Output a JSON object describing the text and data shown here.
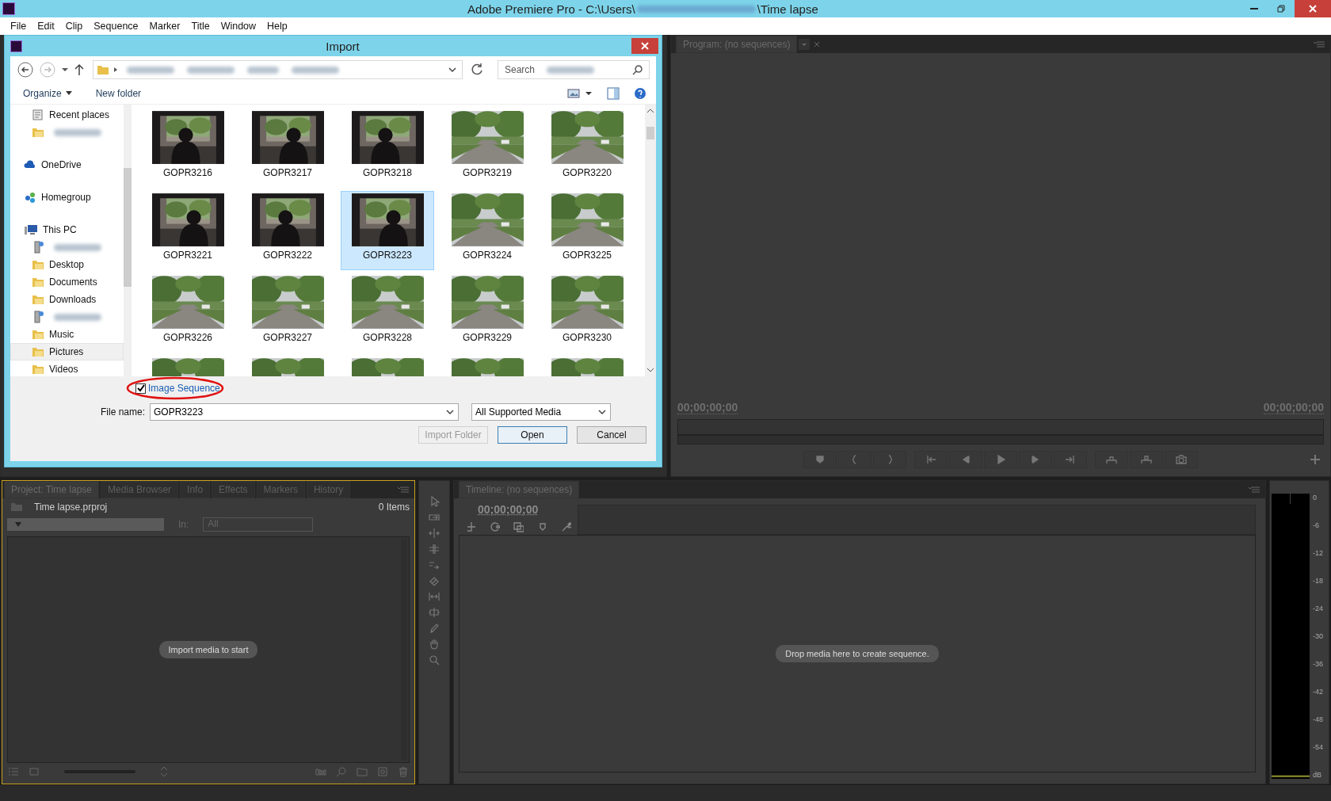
{
  "window": {
    "title_start": "Adobe Premiere Pro - C:\\Users\\",
    "title_end": "\\Time lapse"
  },
  "menu": [
    "File",
    "Edit",
    "Clip",
    "Sequence",
    "Marker",
    "Title",
    "Window",
    "Help"
  ],
  "import_dialog": {
    "title": "Import",
    "search": {
      "placeholder": "Search"
    },
    "organize": "Organize",
    "new_folder": "New folder",
    "sidebar": [
      {
        "kind": "item",
        "label": "Recent places",
        "selected": false
      },
      {
        "kind": "blurred",
        "selected": false
      },
      {
        "kind": "group",
        "label": "OneDrive",
        "selected": false
      },
      {
        "kind": "group",
        "label": "Homegroup",
        "selected": false
      },
      {
        "kind": "group",
        "label": "This PC",
        "selected": false
      },
      {
        "kind": "blurred",
        "selected": false
      },
      {
        "kind": "item",
        "label": "Desktop",
        "selected": false
      },
      {
        "kind": "item",
        "label": "Documents",
        "selected": false
      },
      {
        "kind": "item",
        "label": "Downloads",
        "selected": false
      },
      {
        "kind": "blurred",
        "selected": false
      },
      {
        "kind": "item",
        "label": "Music",
        "selected": false
      },
      {
        "kind": "item",
        "label": "Pictures",
        "selected": true
      },
      {
        "kind": "item",
        "label": "Videos",
        "selected": false
      }
    ],
    "files": [
      {
        "label": "GOPR3216",
        "selected": false
      },
      {
        "label": "GOPR3217",
        "selected": false
      },
      {
        "label": "GOPR3218",
        "selected": false
      },
      {
        "label": "GOPR3219",
        "selected": false
      },
      {
        "label": "GOPR3220",
        "selected": false
      },
      {
        "label": "GOPR3221",
        "selected": false
      },
      {
        "label": "GOPR3222",
        "selected": false
      },
      {
        "label": "GOPR3223",
        "selected": true
      },
      {
        "label": "GOPR3224",
        "selected": false
      },
      {
        "label": "GOPR3225",
        "selected": false
      },
      {
        "label": "GOPR3226",
        "selected": false
      },
      {
        "label": "GOPR3227",
        "selected": false
      },
      {
        "label": "GOPR3228",
        "selected": false
      },
      {
        "label": "GOPR3229",
        "selected": false
      },
      {
        "label": "GOPR3230",
        "selected": false
      },
      {
        "kind": "picture",
        "selected": false
      },
      {
        "kind": "picture",
        "selected": false
      },
      {
        "kind": "picture",
        "selected": false
      },
      {
        "kind": "picture",
        "selected": false
      },
      {
        "kind": "picture",
        "selected": false
      }
    ],
    "image_sequence": {
      "label": "Image Sequence",
      "checked": true
    },
    "file_name_label": "File name:",
    "file_name": "GOPR3223",
    "file_type": "All Supported Media",
    "buttons": [
      {
        "label": "Import Folder",
        "disabled": true,
        "default": false
      },
      {
        "label": "Open",
        "disabled": false,
        "default": true
      },
      {
        "label": "Cancel",
        "disabled": false,
        "default": false
      }
    ]
  },
  "program_monitor": {
    "tab": "Program: (no sequences)",
    "timecode_left": "00;00;00;00",
    "timecode_right": "00;00;00;00"
  },
  "project_panel": {
    "tabs": [
      {
        "label": "Project: Time lapse",
        "selected": true
      },
      {
        "label": "Media Browser",
        "selected": false
      },
      {
        "label": "Info",
        "selected": false
      },
      {
        "label": "Effects",
        "selected": false
      },
      {
        "label": "Markers",
        "selected": false
      },
      {
        "label": "History",
        "selected": false
      }
    ],
    "project_file": "Time lapse.prproj",
    "item_count": "0 Items",
    "in_label": "In:",
    "in_value": "All",
    "empty_hint": "Import media to start"
  },
  "timeline": {
    "tab": "Timeline: (no sequences)",
    "timecode": "00;00;00;00",
    "empty_hint": "Drop media here to create sequence."
  },
  "audio_meter": {
    "scale": [
      "0",
      "-6",
      "-12",
      "-18",
      "-24",
      "-30",
      "-36",
      "-42",
      "-48",
      "-54",
      "dB"
    ]
  }
}
